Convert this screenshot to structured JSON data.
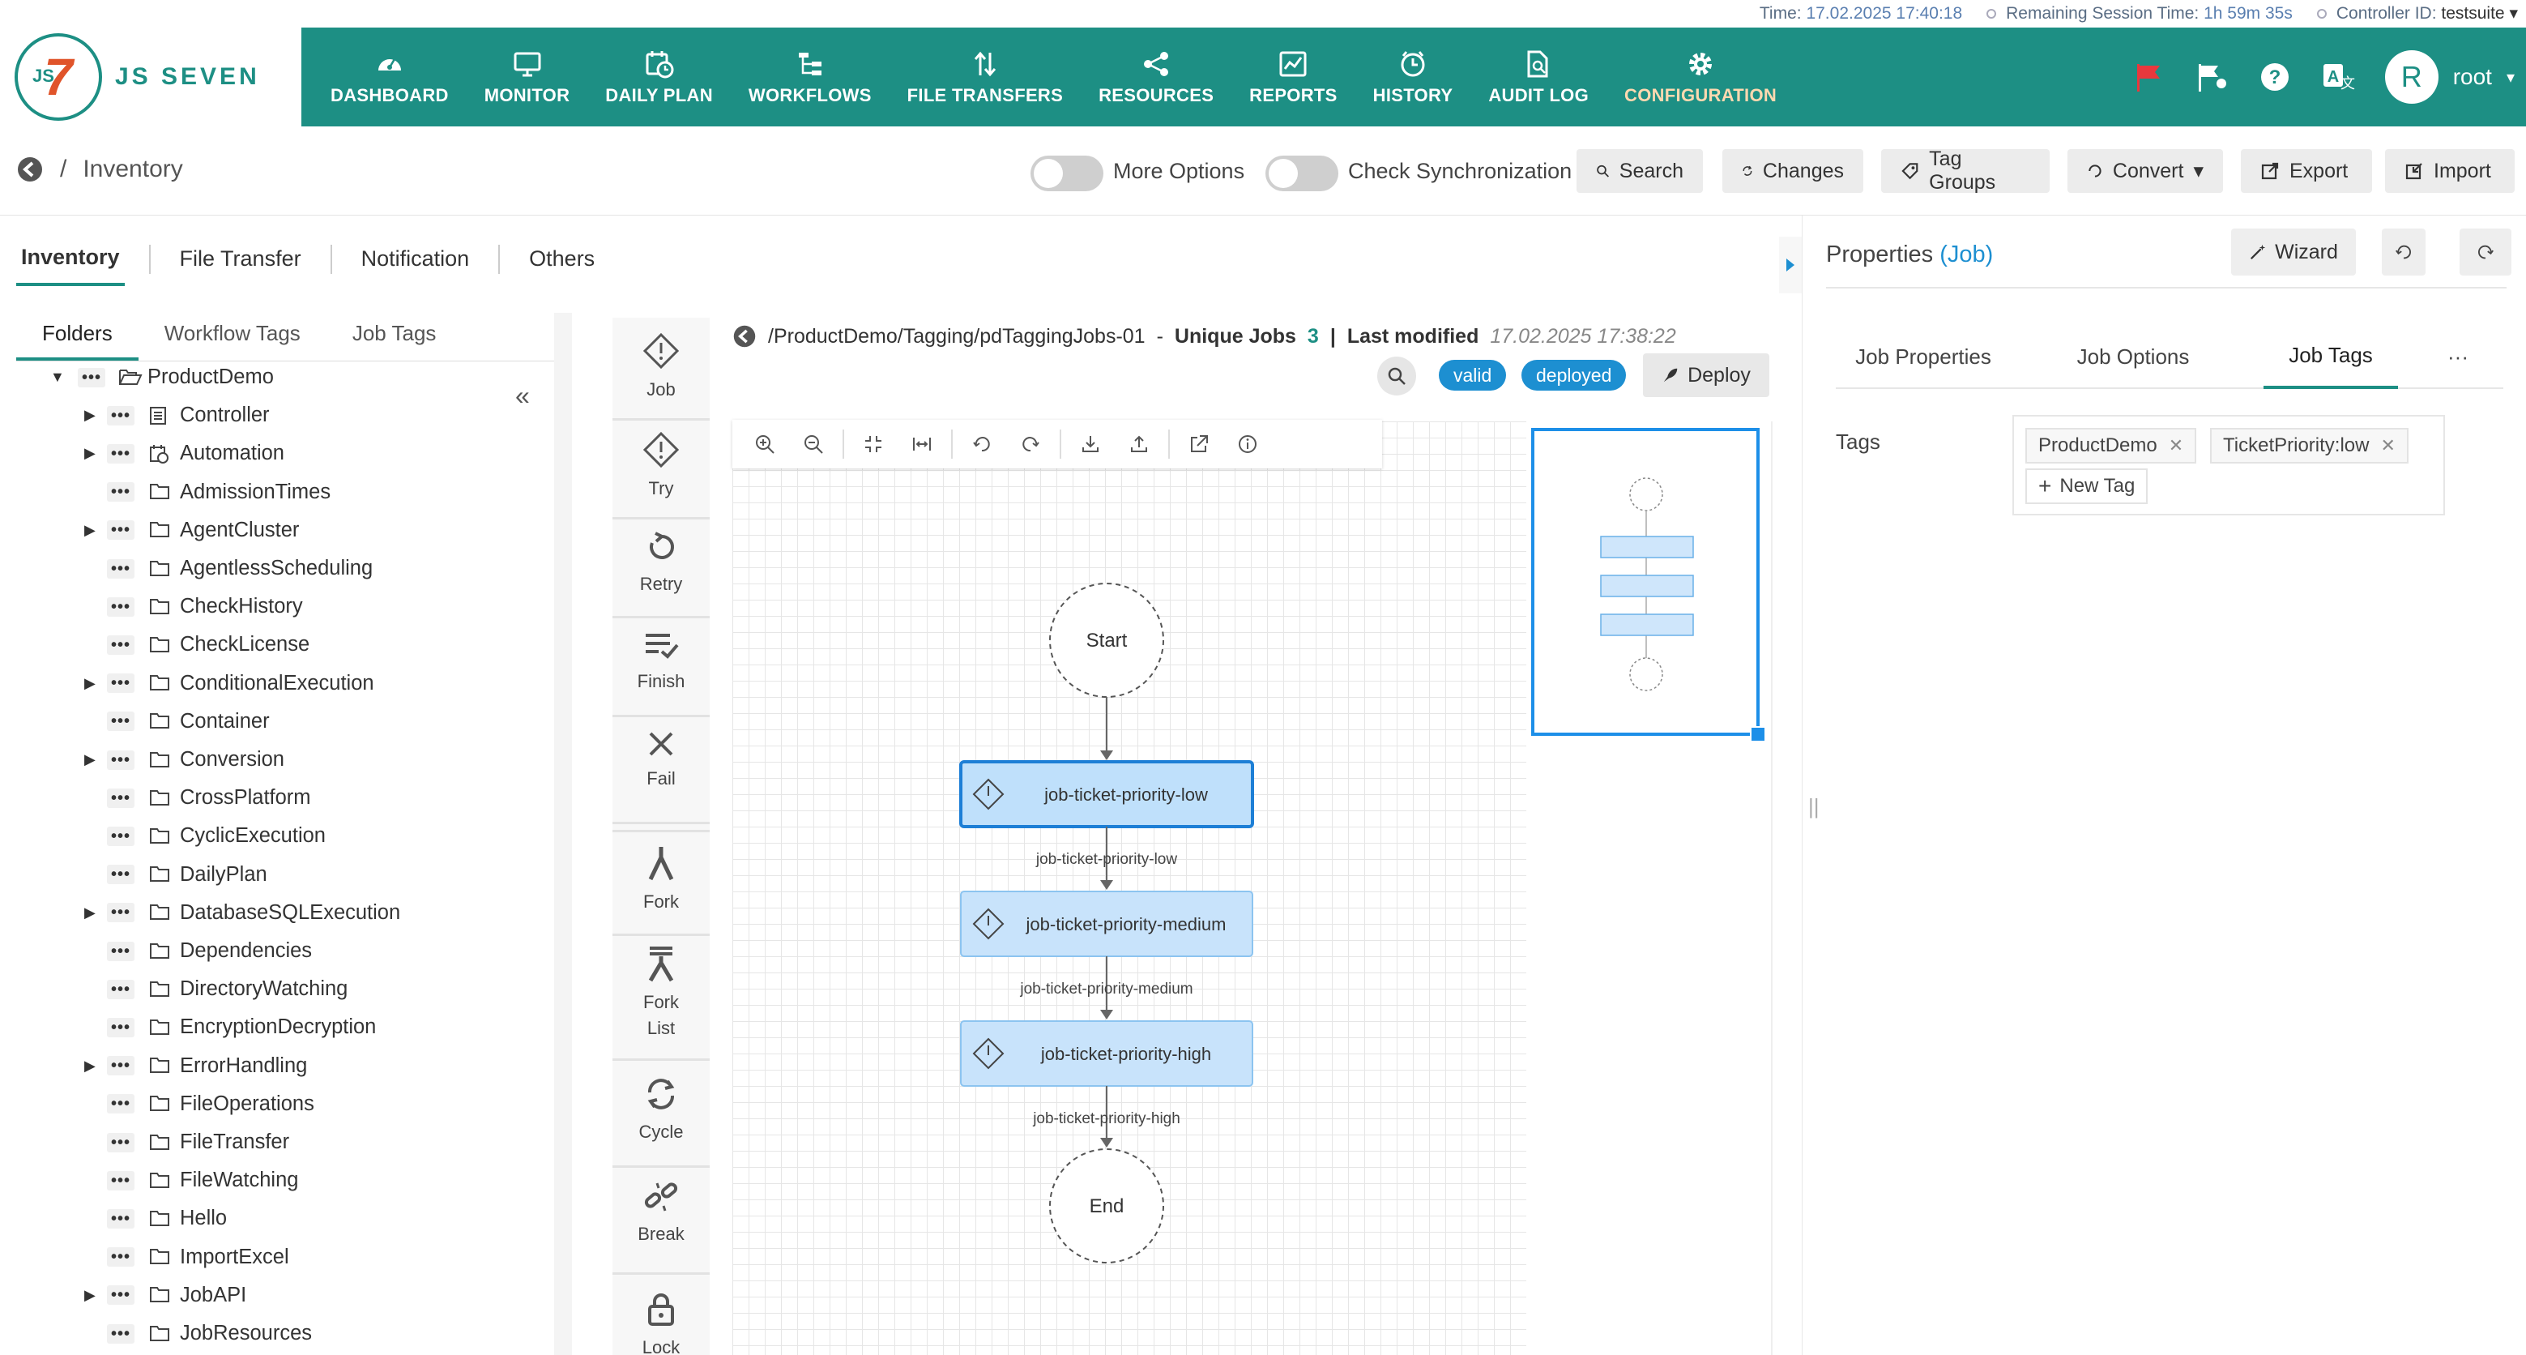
{
  "status_bar": {
    "time_label": "Time:",
    "time_value": "17.02.2025 17:40:18",
    "session_label": "Remaining Session Time:",
    "session_value": "1h 59m 35s",
    "controller_label": "Controller ID:",
    "controller_value": "testsuite"
  },
  "header": {
    "logo_js": "JS",
    "logo_seven": "7",
    "logo_text": "JS SEVEN",
    "nav": [
      {
        "label": "DASHBOARD",
        "icon": "dashboard-gauge-icon"
      },
      {
        "label": "MONITOR",
        "icon": "monitor-icon"
      },
      {
        "label": "DAILY PLAN",
        "icon": "calendar-clock-icon"
      },
      {
        "label": "WORKFLOWS",
        "icon": "workflow-tree-icon"
      },
      {
        "label": "FILE TRANSFERS",
        "icon": "transfer-arrows-icon"
      },
      {
        "label": "RESOURCES",
        "icon": "share-nodes-icon"
      },
      {
        "label": "REPORTS",
        "icon": "chart-line-icon"
      },
      {
        "label": "HISTORY",
        "icon": "history-clock-icon"
      },
      {
        "label": "AUDIT LOG",
        "icon": "file-search-icon"
      },
      {
        "label": "CONFIGURATION",
        "icon": "gear-icon"
      }
    ],
    "active_nav": "CONFIGURATION",
    "user_initial": "R",
    "user_name": "root"
  },
  "toolbar": {
    "breadcrumb": "Inventory",
    "more_options": "More Options",
    "check_sync": "Check Synchronization",
    "search": "Search",
    "changes": "Changes",
    "tag_groups": "Tag Groups",
    "convert": "Convert",
    "export": "Export",
    "import": "Import"
  },
  "main_tabs": [
    "Inventory",
    "File Transfer",
    "Notification",
    "Others"
  ],
  "sub_tabs": [
    "Folders",
    "Workflow Tags",
    "Job Tags"
  ],
  "tree": [
    {
      "label": "ProductDemo",
      "expandable": true,
      "expanded": true,
      "icon": "folder-open-icon",
      "level": 0
    },
    {
      "label": "Controller",
      "expandable": true,
      "icon": "controller-icon"
    },
    {
      "label": "Automation",
      "expandable": true,
      "icon": "calendar-icon"
    },
    {
      "label": "AdmissionTimes",
      "expandable": false,
      "icon": "folder-icon"
    },
    {
      "label": "AgentCluster",
      "expandable": true,
      "icon": "folder-icon"
    },
    {
      "label": "AgentlessScheduling",
      "expandable": false,
      "icon": "folder-icon"
    },
    {
      "label": "CheckHistory",
      "expandable": false,
      "icon": "folder-icon"
    },
    {
      "label": "CheckLicense",
      "expandable": false,
      "icon": "folder-icon"
    },
    {
      "label": "ConditionalExecution",
      "expandable": true,
      "icon": "folder-icon"
    },
    {
      "label": "Container",
      "expandable": false,
      "icon": "folder-icon"
    },
    {
      "label": "Conversion",
      "expandable": true,
      "icon": "folder-icon"
    },
    {
      "label": "CrossPlatform",
      "expandable": false,
      "icon": "folder-icon"
    },
    {
      "label": "CyclicExecution",
      "expandable": false,
      "icon": "folder-icon"
    },
    {
      "label": "DailyPlan",
      "expandable": false,
      "icon": "folder-icon"
    },
    {
      "label": "DatabaseSQLExecution",
      "expandable": true,
      "icon": "folder-icon"
    },
    {
      "label": "Dependencies",
      "expandable": false,
      "icon": "folder-icon"
    },
    {
      "label": "DirectoryWatching",
      "expandable": false,
      "icon": "folder-icon"
    },
    {
      "label": "EncryptionDecryption",
      "expandable": false,
      "icon": "folder-icon"
    },
    {
      "label": "ErrorHandling",
      "expandable": true,
      "icon": "folder-icon"
    },
    {
      "label": "FileOperations",
      "expandable": false,
      "icon": "folder-icon"
    },
    {
      "label": "FileTransfer",
      "expandable": false,
      "icon": "folder-icon"
    },
    {
      "label": "FileWatching",
      "expandable": false,
      "icon": "folder-icon"
    },
    {
      "label": "Hello",
      "expandable": false,
      "icon": "folder-icon"
    },
    {
      "label": "ImportExcel",
      "expandable": false,
      "icon": "folder-icon"
    },
    {
      "label": "JobAPI",
      "expandable": true,
      "icon": "folder-icon"
    },
    {
      "label": "JobResources",
      "expandable": false,
      "icon": "folder-icon"
    }
  ],
  "palette": [
    {
      "label": "Job",
      "icon": "job-diamond-icon"
    },
    {
      "label": "Try",
      "icon": "try-diamond-icon"
    },
    {
      "label": "Retry",
      "icon": "retry-icon"
    },
    {
      "label": "Finish",
      "icon": "finish-icon"
    },
    {
      "label": "Fail",
      "icon": "fail-x-icon"
    },
    {
      "label": "Fork",
      "icon": "fork-icon"
    },
    {
      "label": "Fork",
      "label2": "List",
      "icon": "fork-list-icon"
    },
    {
      "label": "Cycle",
      "icon": "cycle-icon"
    },
    {
      "label": "Break",
      "icon": "break-chain-icon"
    },
    {
      "label": "Lock",
      "icon": "lock-icon"
    }
  ],
  "workflow": {
    "path": "/ProductDemo/Tagging/pdTaggingJobs-01",
    "separator": "-",
    "unique_jobs_label": "Unique Jobs",
    "unique_jobs_count": "3",
    "pipe": "|",
    "last_modified_label": "Last modified",
    "last_modified_value": "17.02.2025 17:38:22",
    "status_valid": "valid",
    "status_deployed": "deployed",
    "deploy_label": "Deploy",
    "start_label": "Start",
    "end_label": "End",
    "jobs": [
      {
        "name": "job-ticket-priority-low",
        "edge_label": "job-ticket-priority-low",
        "selected": true
      },
      {
        "name": "job-ticket-priority-medium",
        "edge_label": "job-ticket-priority-medium",
        "selected": false
      },
      {
        "name": "job-ticket-priority-high",
        "edge_label": "job-ticket-priority-high",
        "selected": false
      }
    ]
  },
  "properties": {
    "title": "Properties",
    "title_type": "(Job)",
    "wizard": "Wizard",
    "tabs": [
      "Job Properties",
      "Job Options",
      "Job Tags"
    ],
    "active_tab": "Job Tags",
    "more": "···",
    "tags_label": "Tags",
    "tags": [
      "ProductDemo",
      "TicketPriority:low"
    ],
    "new_tag": "New Tag"
  },
  "colors": {
    "brand": "#1d8f84",
    "accent_blue": "#1d8fd1",
    "flag_red": "#e8383d"
  }
}
